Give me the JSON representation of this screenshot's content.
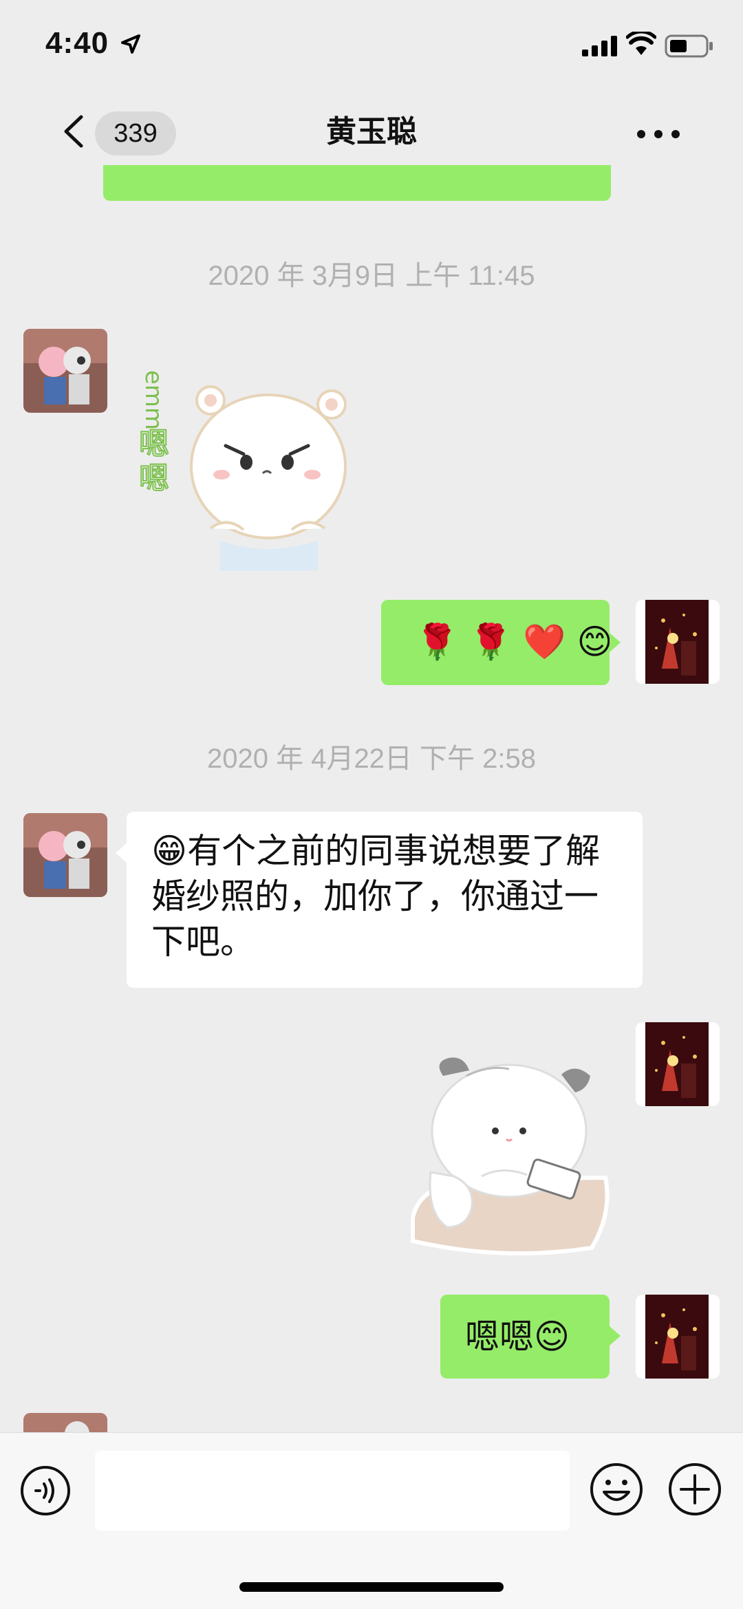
{
  "status_bar": {
    "time": "4:40"
  },
  "nav": {
    "back_count": "339",
    "title": "黄玉聪"
  },
  "messages": [
    {
      "type": "timestamp",
      "text": "2020 年 3月9日 上午 11:45"
    },
    {
      "type": "sticker",
      "side": "left",
      "sticker_text": "emm 嗯嗯",
      "sticker_name": "hamster-grumpy-sticker"
    },
    {
      "type": "text",
      "side": "right",
      "text": "🌹 🌹 ❤️ 😊"
    },
    {
      "type": "timestamp",
      "text": "2020 年 4月22日 下午 2:58"
    },
    {
      "type": "text",
      "side": "left",
      "text": "😁有个之前的同事说想要了解婚纱照的，加你了，你通过一下吧。"
    },
    {
      "type": "sticker",
      "side": "right",
      "sticker_name": "cat-leaning-on-table-sticker"
    },
    {
      "type": "text",
      "side": "right",
      "text": "嗯嗯😊"
    }
  ],
  "input": {
    "value": "",
    "placeholder": ""
  },
  "colors": {
    "background": "#ededed",
    "bubble_self": "#95ec69",
    "bubble_other": "#ffffff",
    "timestamp": "#b0b0b0"
  },
  "icons": [
    "location-arrow-icon",
    "signal-icon",
    "wifi-icon",
    "battery-icon",
    "back-chevron-icon",
    "more-icon",
    "voice-icon",
    "emoji-icon",
    "plus-icon"
  ]
}
